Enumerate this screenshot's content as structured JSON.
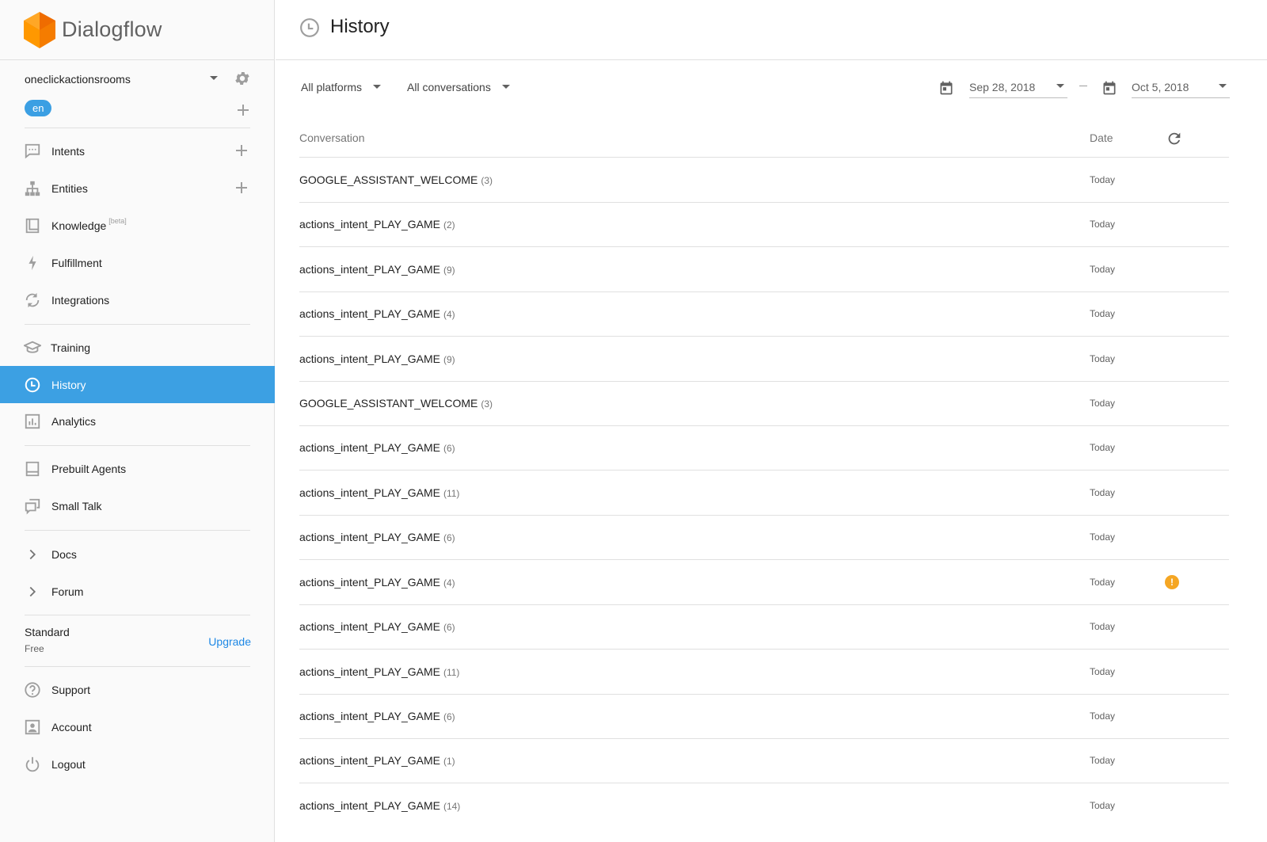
{
  "brand": {
    "name": "Dialogflow"
  },
  "agent": {
    "name": "oneclickactionsrooms",
    "language": "en"
  },
  "nav": {
    "intents": "Intents",
    "entities": "Entities",
    "knowledge": "Knowledge",
    "knowledge_badge": "[beta]",
    "fulfillment": "Fulfillment",
    "integrations": "Integrations",
    "training": "Training",
    "history": "History",
    "analytics": "Analytics",
    "prebuilt_agents": "Prebuilt Agents",
    "small_talk": "Small Talk",
    "docs": "Docs",
    "forum": "Forum",
    "support": "Support",
    "account": "Account",
    "logout": "Logout"
  },
  "plan": {
    "name": "Standard",
    "tier": "Free",
    "upgrade": "Upgrade"
  },
  "page": {
    "title": "History"
  },
  "filters": {
    "platform": "All platforms",
    "conversations": "All conversations",
    "date_from": "Sep 28, 2018",
    "date_to": "Oct 5, 2018"
  },
  "table": {
    "col_conversation": "Conversation",
    "col_date": "Date",
    "rows": [
      {
        "name": "GOOGLE_ASSISTANT_WELCOME",
        "count": "(3)",
        "date": "Today"
      },
      {
        "name": "actions_intent_PLAY_GAME",
        "count": "(2)",
        "date": "Today"
      },
      {
        "name": "actions_intent_PLAY_GAME",
        "count": "(9)",
        "date": "Today"
      },
      {
        "name": "actions_intent_PLAY_GAME",
        "count": "(4)",
        "date": "Today"
      },
      {
        "name": "actions_intent_PLAY_GAME",
        "count": "(9)",
        "date": "Today"
      },
      {
        "name": "GOOGLE_ASSISTANT_WELCOME",
        "count": "(3)",
        "date": "Today"
      },
      {
        "name": "actions_intent_PLAY_GAME",
        "count": "(6)",
        "date": "Today"
      },
      {
        "name": "actions_intent_PLAY_GAME",
        "count": "(11)",
        "date": "Today"
      },
      {
        "name": "actions_intent_PLAY_GAME",
        "count": "(6)",
        "date": "Today"
      },
      {
        "name": "actions_intent_PLAY_GAME",
        "count": "(4)",
        "date": "Today",
        "warning": "!"
      },
      {
        "name": "actions_intent_PLAY_GAME",
        "count": "(6)",
        "date": "Today"
      },
      {
        "name": "actions_intent_PLAY_GAME",
        "count": "(11)",
        "date": "Today"
      },
      {
        "name": "actions_intent_PLAY_GAME",
        "count": "(6)",
        "date": "Today"
      },
      {
        "name": "actions_intent_PLAY_GAME",
        "count": "(1)",
        "date": "Today"
      },
      {
        "name": "actions_intent_PLAY_GAME",
        "count": "(14)",
        "date": "Today"
      }
    ]
  },
  "colors": {
    "accent": "#3ca0e3",
    "logo_orange": "#ff9800",
    "warning": "#f5a623",
    "link": "#1e88e5"
  }
}
